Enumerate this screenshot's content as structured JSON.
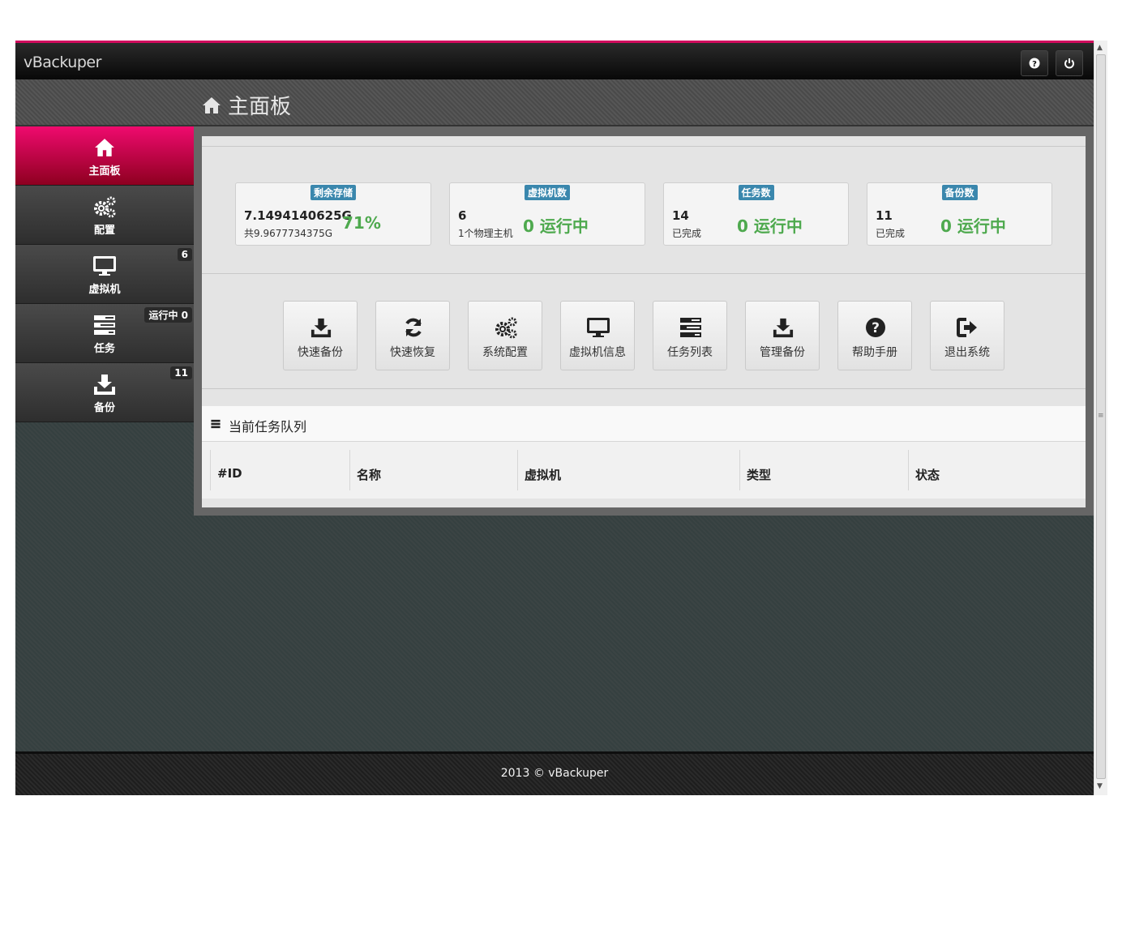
{
  "app": {
    "brand": "vBackuper"
  },
  "header": {
    "title": "主面板"
  },
  "sidebar": {
    "items": [
      {
        "label": "主面板",
        "badge": ""
      },
      {
        "label": "配置",
        "badge": ""
      },
      {
        "label": "虚拟机",
        "badge": "6"
      },
      {
        "label": "任务",
        "badge": "运行中 0"
      },
      {
        "label": "备份",
        "badge": "11"
      }
    ]
  },
  "stats": {
    "storage": {
      "tag": "剩余存储",
      "value": "7.1494140625G",
      "sub": "共9.9677734375G",
      "percent": "71%"
    },
    "vms": {
      "tag": "虚拟机数",
      "value": "6",
      "sub": "1个物理主机",
      "running": "0 运行中"
    },
    "tasks": {
      "tag": "任务数",
      "value": "14",
      "sub": "已完成",
      "running": "0 运行中"
    },
    "backups": {
      "tag": "备份数",
      "value": "11",
      "sub": "已完成",
      "running": "0 运行中"
    }
  },
  "quick_actions": [
    {
      "label": "快速备份",
      "icon": "download-icon"
    },
    {
      "label": "快速恢复",
      "icon": "refresh-icon"
    },
    {
      "label": "系统配置",
      "icon": "gears-icon"
    },
    {
      "label": "虚拟机信息",
      "icon": "monitor-icon"
    },
    {
      "label": "任务列表",
      "icon": "tasks-icon"
    },
    {
      "label": "管理备份",
      "icon": "download-icon"
    },
    {
      "label": "帮助手册",
      "icon": "question-icon"
    },
    {
      "label": "退出系统",
      "icon": "signout-icon"
    }
  ],
  "queue": {
    "title": "当前任务队列",
    "columns": [
      "#ID",
      "名称",
      "虚拟机",
      "类型",
      "状态"
    ]
  },
  "footer": {
    "text": "2013 © vBackuper"
  },
  "colors": {
    "accent": "#d10a5e",
    "green": "#4ea94e",
    "tag": "#3a87ad"
  }
}
